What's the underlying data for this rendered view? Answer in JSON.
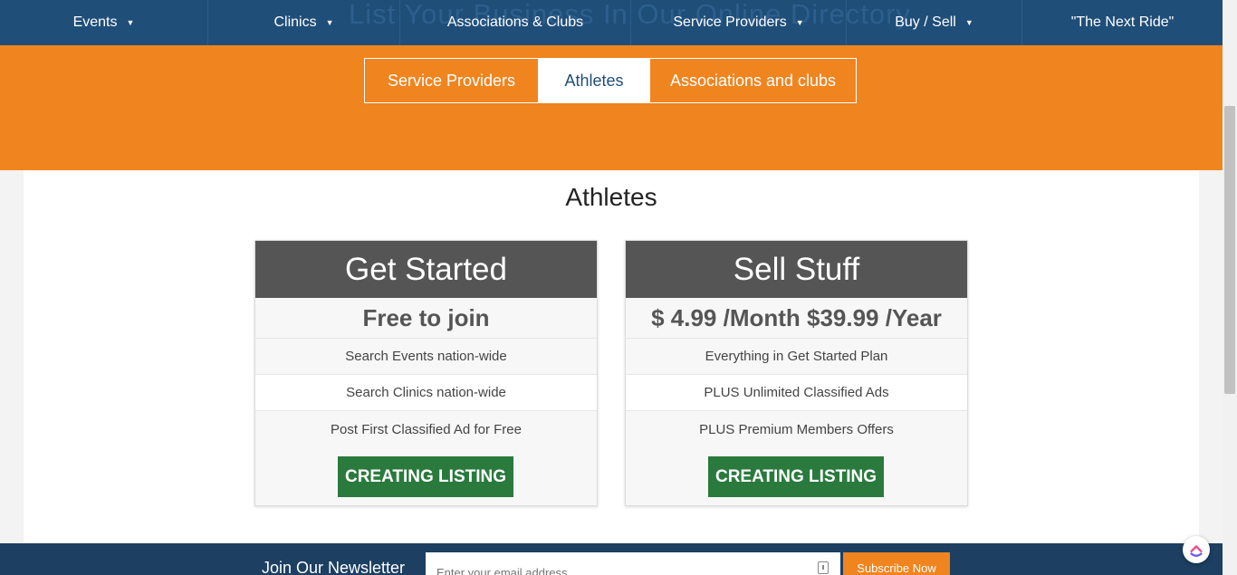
{
  "nav": {
    "ghost_heading": "List Your Business In Our Online Directory",
    "items": [
      {
        "label": "Events",
        "caret": "▼"
      },
      {
        "label": "Clinics",
        "caret": "▼"
      },
      {
        "label": "Associations & Clubs",
        "caret": ""
      },
      {
        "label": "Service Providers",
        "caret": "▼"
      },
      {
        "label": "Buy / Sell",
        "caret": "▼"
      },
      {
        "label": "\"The Next Ride\"",
        "caret": ""
      }
    ]
  },
  "tabs": [
    {
      "label": "Service Providers",
      "active": false
    },
    {
      "label": "Athletes",
      "active": true
    },
    {
      "label": "Associations and clubs",
      "active": false
    }
  ],
  "section": {
    "title": "Athletes"
  },
  "plans": [
    {
      "name": "Get Started",
      "price": "Free to join",
      "features": [
        "Search Events nation-wide",
        "Search Clinics nation-wide",
        "Post First Classified Ad for Free"
      ],
      "cta": "CREATING LISTING"
    },
    {
      "name": "Sell Stuff",
      "price": "$ 4.99 /Month $39.99 /Year",
      "features": [
        "Everything in Get Started Plan",
        "PLUS Unlimited Classified Ads",
        "PLUS Premium Members Offers"
      ],
      "cta": "CREATING LISTING"
    }
  ],
  "newsletter": {
    "label": "Join Our Newsletter",
    "placeholder": "Enter your email address",
    "button": "Subscribe Now"
  },
  "colors": {
    "nav_bg": "#1f4e79",
    "hero_bg": "#f0841f",
    "card_head_bg": "#555555",
    "cta_bg": "#2a7a3d",
    "footer_bg": "#1c3f62"
  },
  "icons": {
    "caret": "caret-down-icon",
    "input_icon": "autofill-icon",
    "widget": "help-widget-icon"
  }
}
